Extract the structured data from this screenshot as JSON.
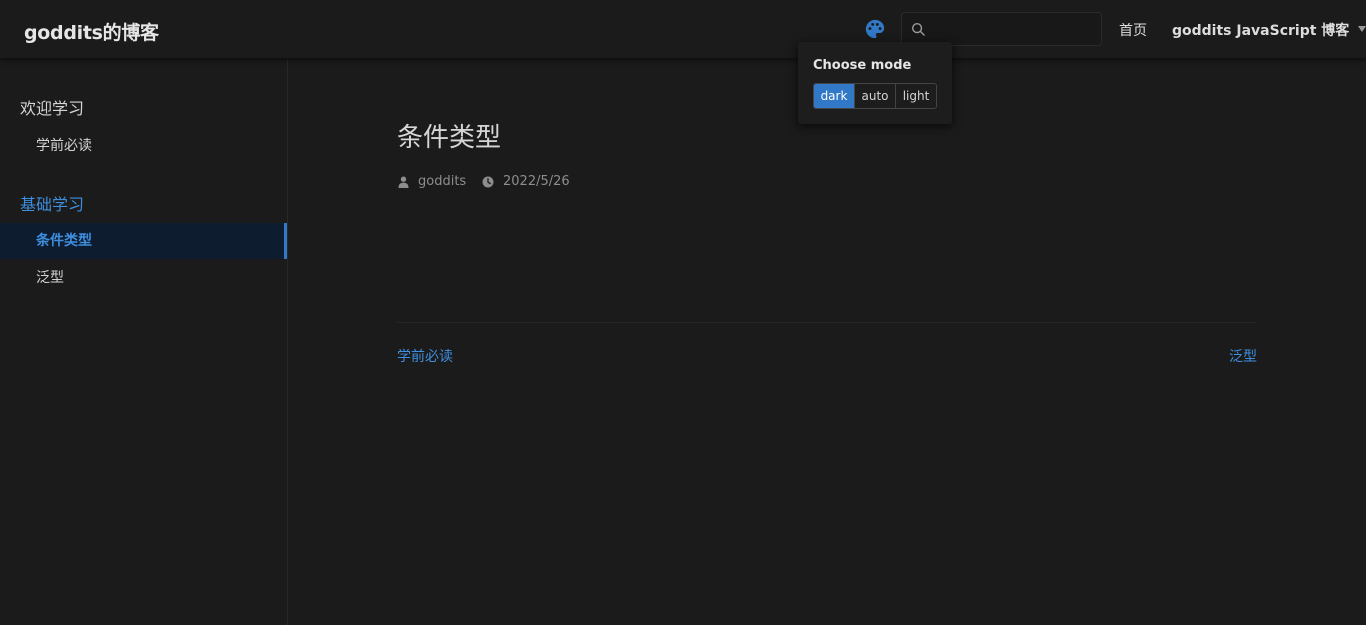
{
  "navbar": {
    "site_name": "goddits的博客",
    "search": {
      "value": "",
      "placeholder": ""
    },
    "links": {
      "home": "首页",
      "dropdown": "goddits JavaScript 博客"
    }
  },
  "mode_popover": {
    "title": "Choose mode",
    "options": [
      "dark",
      "auto",
      "light"
    ],
    "selected": "dark"
  },
  "sidebar": {
    "groups": [
      {
        "label": "欢迎学习",
        "items": [
          {
            "label": "学前必读"
          }
        ]
      },
      {
        "label": "基础学习",
        "items": [
          {
            "label": "条件类型"
          },
          {
            "label": "泛型"
          }
        ]
      }
    ],
    "active_item": "条件类型"
  },
  "page": {
    "title": "条件类型",
    "author": "goddits",
    "date": "2022/5/26",
    "prev": "学前必读",
    "next": "泛型"
  },
  "icons": {
    "palette": "palette-icon",
    "search": "search-icon",
    "author": "user-icon",
    "date": "clock-icon"
  },
  "colors": {
    "accent": "#3178c6",
    "link": "#3e8edf",
    "background": "#1b1b1b"
  }
}
